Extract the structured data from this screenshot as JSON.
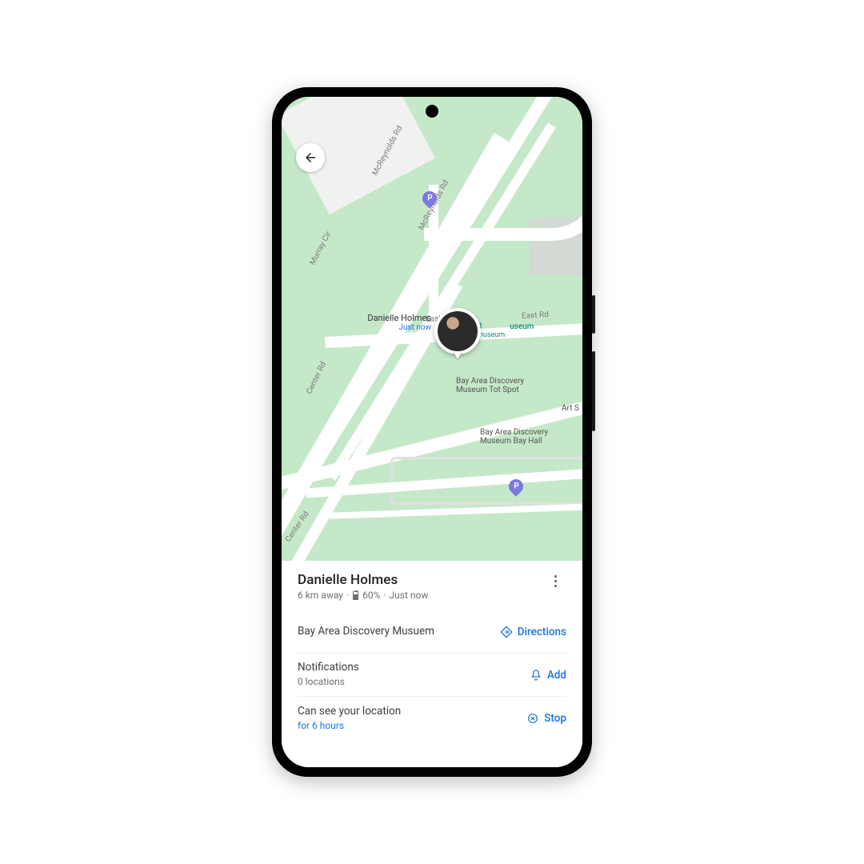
{
  "back_label": "Back",
  "map": {
    "roads": {
      "mcreynolds": "McReynolds Rd",
      "murray": "Murray Cir",
      "center": "Center Rd",
      "east": "East Rd"
    },
    "pois": {
      "museum_line1": "useum",
      "museum_line2": "museum",
      "tot_spot": "Bay Area Discovery\nMuseum Tot Spot",
      "bay_hall": "Bay Area Discovery\nMuseum Bay Hall",
      "art_s": "Art S"
    },
    "parking_glyph": "P",
    "marker": {
      "name": "Danielle Holmes",
      "status": "Just now"
    }
  },
  "card": {
    "name": "Danielle Holmes",
    "distance": "6 km away",
    "battery": "60%",
    "updated": "Just now",
    "location": {
      "title": "Bay Area Discovery Musuem",
      "action": "Directions"
    },
    "notifications": {
      "title": "Notifications",
      "subtitle": "0 locations",
      "action": "Add"
    },
    "sharing": {
      "title": "Can see your location",
      "subtitle": "for 6 hours",
      "action": "Stop"
    },
    "overflow_label": "More options"
  }
}
